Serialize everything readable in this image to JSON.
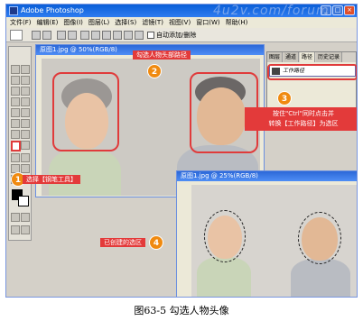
{
  "app": {
    "title": "Adobe Photoshop",
    "menu": [
      "文件(F)",
      "编辑(E)",
      "图像(I)",
      "图层(L)",
      "选择(S)",
      "滤镜(T)",
      "视图(V)",
      "窗口(W)",
      "帮助(H)"
    ],
    "options": {
      "auto_add_delete_label": "自动添加/删除"
    },
    "window_buttons": [
      "_",
      "□",
      "×"
    ]
  },
  "watermark": "4u2v.com/forum",
  "documents": [
    {
      "title": "原图1.jpg @ 50%(RGB/8)"
    },
    {
      "title": "原图1.jpg @ 25%(RGB/8)"
    }
  ],
  "paths_panel": {
    "tabs": [
      "图层",
      "通道",
      "路径",
      "历史记录"
    ],
    "path_name": "工作路径"
  },
  "callouts": {
    "c1": {
      "num": "1",
      "text": "选择【钢笔工具】"
    },
    "c2": {
      "num": "2",
      "text": "勾选人物头部路径"
    },
    "c3": {
      "num": "3",
      "text_line1": "按住\"Ctrl\"同时点击并",
      "text_line2": "转换【工作路径】为选区"
    },
    "c4": {
      "num": "4",
      "text": "已创建的选区"
    }
  },
  "caption": "图63-5   勾选人物头像"
}
